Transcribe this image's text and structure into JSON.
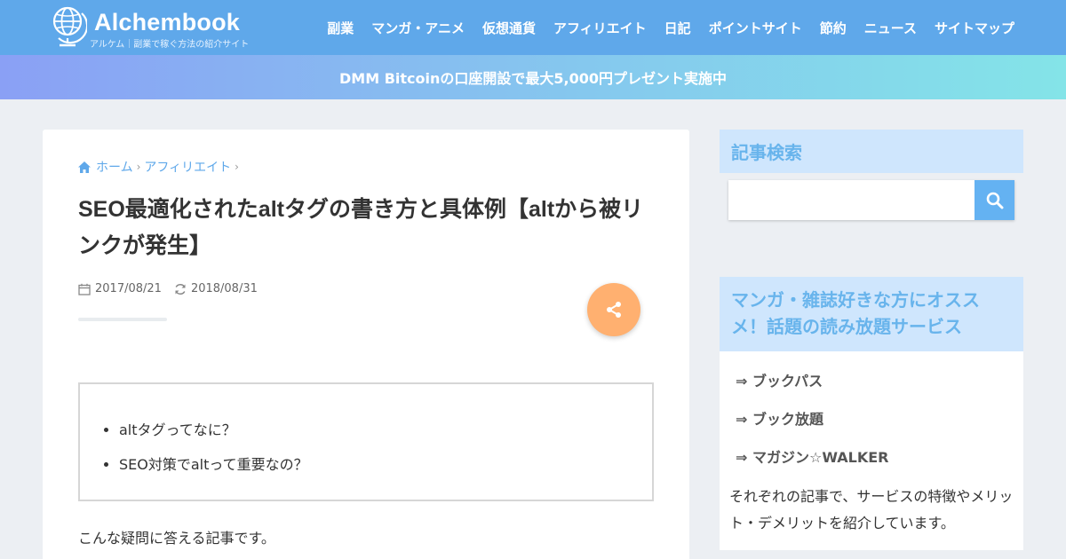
{
  "header": {
    "logo_title": "Alchembook",
    "logo_subtitle": "アルケム｜副業で稼ぐ方法の紹介サイト",
    "nav": [
      "副業",
      "マンガ・アニメ",
      "仮想通貨",
      "アフィリエイト",
      "日記",
      "ポイントサイト",
      "節約",
      "ニュース",
      "サイトマップ"
    ]
  },
  "promo": {
    "text": "DMM Bitcoinの口座開設で最大5,000円プレゼント実施中"
  },
  "article": {
    "breadcrumb": [
      "ホーム",
      "アフィリエイト"
    ],
    "title": "SEO最適化されたaltタグの書き方と具体例【altから被リンクが発生】",
    "posted_date": "2017/08/21",
    "updated_date": "2018/08/31",
    "toc": [
      "altタグってなに？",
      "SEO対策でaltって重要なの？"
    ],
    "intro": "こんな疑問に答える記事です。"
  },
  "sidebar": {
    "search_title": "記事検索",
    "search_placeholder": "",
    "manga_title": "マンガ・雑誌好きな方にオススメ！話題の読み放題サービス",
    "manga_links": [
      "⇒ ブックパス",
      "⇒ ブック放題",
      "⇒ マガジン☆WALKER"
    ],
    "manga_desc": "それぞれの記事で、サービスの特徴やメリット・デメリットを紹介しています。"
  },
  "colors": {
    "header_bg": "#5fa8ea",
    "promo_gradient_start": "#8aa0f5",
    "promo_gradient_end": "#84e4e8",
    "accent_link": "#5fa8ea",
    "share_button": "#ffb070",
    "sidebar_heading_bg": "#cfe6fd",
    "sidebar_heading_text": "#68b4ec"
  },
  "icons": {
    "logo": "globe-icon",
    "breadcrumb_home": "home-icon",
    "posted": "calendar-icon",
    "updated": "refresh-icon",
    "share": "share-icon",
    "search": "search-icon"
  }
}
